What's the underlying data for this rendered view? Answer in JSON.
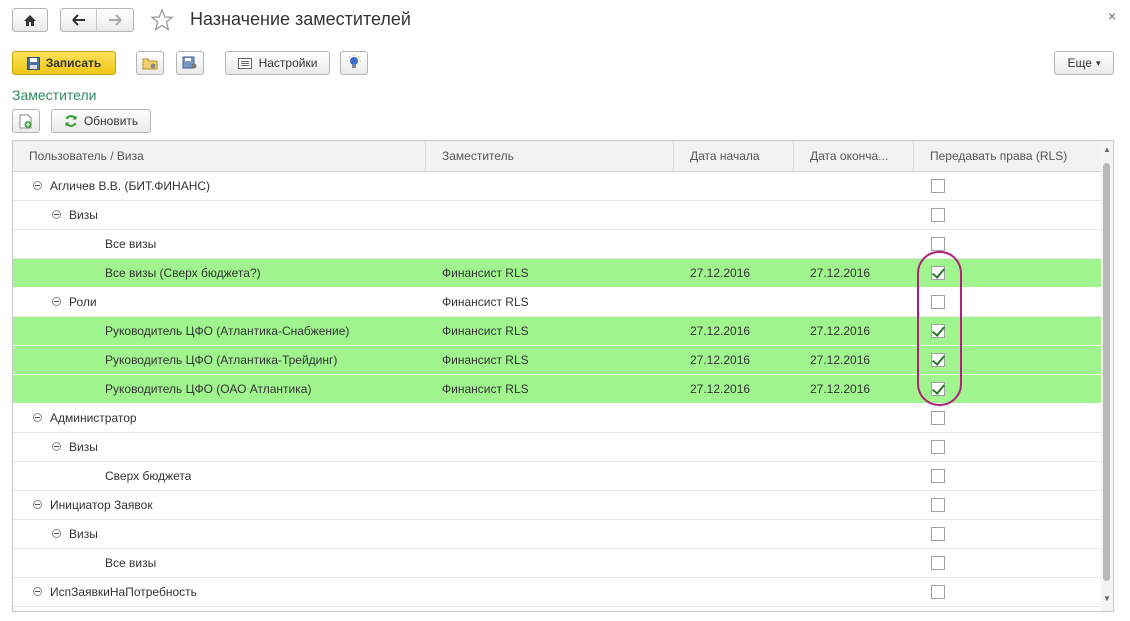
{
  "window": {
    "title": "Назначение заместителей",
    "close_glyph": "×",
    "home_icon": "home-icon",
    "back_icon": "arrow-left-icon",
    "forward_icon": "arrow-right-icon",
    "favorite_icon": "star-icon"
  },
  "toolbar": {
    "save_label": "Записать",
    "settings_label": "Настройки",
    "more_label": "Еще",
    "more_arrow": "▾"
  },
  "section": {
    "title": "Заместители",
    "refresh_label": "Обновить"
  },
  "table": {
    "columns": [
      "Пользователь / Виза",
      "Заместитель",
      "Дата начала",
      "Дата оконча...",
      "Передавать права (RLS)"
    ],
    "rows": [
      {
        "level": 0,
        "name": "Агличев В.В. (БИТ.ФИНАНС)",
        "deputy": "",
        "start": "",
        "end": "",
        "rls": false,
        "highlight": false,
        "expandable": true
      },
      {
        "level": 1,
        "name": "Визы",
        "deputy": "",
        "start": "",
        "end": "",
        "rls": false,
        "highlight": false,
        "expandable": true
      },
      {
        "level": 2,
        "name": "Все визы",
        "deputy": "",
        "start": "",
        "end": "",
        "rls": false,
        "highlight": false,
        "expandable": false
      },
      {
        "level": 2,
        "name": "Все визы (Сверх бюджета?)",
        "deputy": "Финансист RLS",
        "start": "27.12.2016",
        "end": "27.12.2016",
        "rls": true,
        "highlight": true,
        "expandable": false
      },
      {
        "level": 1,
        "name": "Роли",
        "deputy": "Финансист RLS",
        "start": "",
        "end": "",
        "rls": false,
        "highlight": false,
        "expandable": true
      },
      {
        "level": 2,
        "name": "Руководитель ЦФО (Атлантика-Снабжение)",
        "deputy": "Финансист RLS",
        "start": "27.12.2016",
        "end": "27.12.2016",
        "rls": true,
        "highlight": true,
        "expandable": false
      },
      {
        "level": 2,
        "name": "Руководитель ЦФО (Атлантика-Трейдинг)",
        "deputy": "Финансист RLS",
        "start": "27.12.2016",
        "end": "27.12.2016",
        "rls": true,
        "highlight": true,
        "expandable": false
      },
      {
        "level": 2,
        "name": "Руководитель ЦФО (ОАО Атлантика)",
        "deputy": "Финансист RLS",
        "start": "27.12.2016",
        "end": "27.12.2016",
        "rls": true,
        "highlight": true,
        "expandable": false
      },
      {
        "level": 0,
        "name": "Администратор",
        "deputy": "",
        "start": "",
        "end": "",
        "rls": false,
        "highlight": false,
        "expandable": true
      },
      {
        "level": 1,
        "name": "Визы",
        "deputy": "",
        "start": "",
        "end": "",
        "rls": false,
        "highlight": false,
        "expandable": true
      },
      {
        "level": 2,
        "name": "Сверх бюджета",
        "deputy": "",
        "start": "",
        "end": "",
        "rls": false,
        "highlight": false,
        "expandable": false
      },
      {
        "level": 0,
        "name": "Инициатор Заявок",
        "deputy": "",
        "start": "",
        "end": "",
        "rls": false,
        "highlight": false,
        "expandable": true
      },
      {
        "level": 1,
        "name": "Визы",
        "deputy": "",
        "start": "",
        "end": "",
        "rls": false,
        "highlight": false,
        "expandable": true
      },
      {
        "level": 2,
        "name": "Все визы",
        "deputy": "",
        "start": "",
        "end": "",
        "rls": false,
        "highlight": false,
        "expandable": false
      },
      {
        "level": 0,
        "name": "ИспЗаявкиНаПотребность",
        "deputy": "",
        "start": "",
        "end": "",
        "rls": false,
        "highlight": false,
        "expandable": true
      }
    ]
  },
  "colors": {
    "highlight_row": "#a0f58e",
    "annotation_oval": "#b0207a",
    "save_button": "#f5d327",
    "section_title": "#2e8b57"
  }
}
